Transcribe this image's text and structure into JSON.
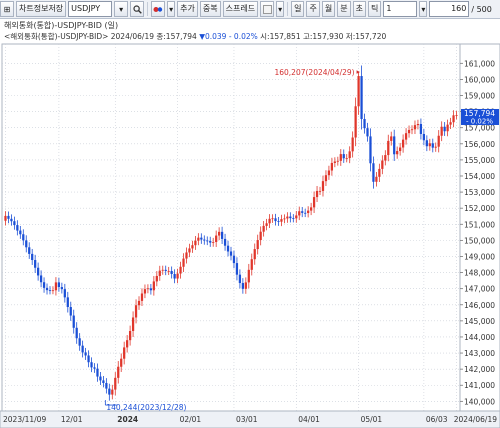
{
  "toolbar": {
    "expand_label": "⊞",
    "save_label": "차트정보저장",
    "symbol": "USDJPY",
    "add_label": "추가",
    "overlay_label": "중복",
    "spread_label": "스프레드",
    "periods": [
      "일",
      "주",
      "월",
      "분",
      "초",
      "틱"
    ],
    "interval_value": "1",
    "count_value": "160",
    "total_value": "/ 500"
  },
  "header": {
    "title": "해외통화(통합)-USDJPY-BID",
    "subtitle_name": "<해외통화(통합)-USDJPY-BID> 2024/06/19 종:157,794",
    "subtitle_change": "▼0.039  - 0.02%",
    "subtitle_rest": "시:157,851 고:157,930 저:157,720"
  },
  "chart_data": {
    "type": "candlestick",
    "title": "해외통화(통합)-USDJPY-BID (일)",
    "ylim": [
      139.4,
      162.2
    ],
    "y_ticks": [
      140,
      141,
      142,
      143,
      144,
      145,
      146,
      147,
      148,
      149,
      150,
      151,
      152,
      153,
      154,
      155,
      156,
      157,
      158,
      159,
      160,
      161
    ],
    "y_tick_labels": [
      "140,000",
      "141,000",
      "142,000",
      "143,000",
      "144,000",
      "145,000",
      "146,000",
      "147,000",
      "148,000",
      "149,000",
      "150,000",
      "151,000",
      "152,000",
      "153,000",
      "154,000",
      "155,000",
      "156,000",
      "157,000",
      "158,000",
      "159,000",
      "160,000",
      "161,000"
    ],
    "x_labels": [
      {
        "index": 0,
        "label": "2023/11/09"
      },
      {
        "index": 18,
        "label": "12/01"
      },
      {
        "index": 37,
        "label": "2024"
      },
      {
        "index": 58,
        "label": "02/01"
      },
      {
        "index": 77,
        "label": "03/01"
      },
      {
        "index": 98,
        "label": "04/01"
      },
      {
        "index": 119,
        "label": "05/01"
      },
      {
        "index": 141,
        "label": "06/03"
      },
      {
        "index": 152,
        "label": "2024/06/19"
      }
    ],
    "markers": {
      "high": {
        "index": 119,
        "value": 160.207,
        "label": "160,207(2024/04/29)"
      },
      "low": {
        "index": 35,
        "value": 140.244,
        "label": "140,244(2023/12/28)"
      }
    },
    "last": {
      "price_label": "157,794",
      "change_label": "- 0.02%"
    },
    "close": [
      151.52,
      151.34,
      151.19,
      150.95,
      150.61,
      150.38,
      150.0,
      149.57,
      149.16,
      148.78,
      148.3,
      147.82,
      147.4,
      147.05,
      146.91,
      146.9,
      146.9,
      147.39,
      147.1,
      146.97,
      146.46,
      145.86,
      145.33,
      144.57,
      143.92,
      143.46,
      143.04,
      142.85,
      142.43,
      142.11,
      142.03,
      141.54,
      141.3,
      141.14,
      140.79,
      140.42,
      140.73,
      141.46,
      142.15,
      142.65,
      143.35,
      143.8,
      144.37,
      145.21,
      145.97,
      146.24,
      146.7,
      146.97,
      147.02,
      146.9,
      147.45,
      147.79,
      148.12,
      148.17,
      148.1,
      148.1,
      147.91,
      147.63,
      147.94,
      148.36,
      148.87,
      149.25,
      149.5,
      149.7,
      149.98,
      150.17,
      150.05,
      149.99,
      149.96,
      149.86,
      149.9,
      150.3,
      150.53,
      150.09,
      149.67,
      149.31,
      149.05,
      148.59,
      147.87,
      147.35,
      146.99,
      147.39,
      148.17,
      148.83,
      149.46,
      150.02,
      150.54,
      150.9,
      151.06,
      151.34,
      151.37,
      151.2,
      151.16,
      151.32,
      151.36,
      151.48,
      151.38,
      151.37,
      151.55,
      151.81,
      151.71,
      151.7,
      151.85,
      152.05,
      152.69,
      153.07,
      153.07,
      153.68,
      154.05,
      154.34,
      154.81,
      154.9,
      154.94,
      155.36,
      155.1,
      155.11,
      155.53,
      156.39,
      158.33,
      160.21,
      157.54,
      156.97,
      156.46,
      154.79,
      153.64,
      153.95,
      154.44,
      154.96,
      155.3,
      156.18,
      156.46,
      155.35,
      155.55,
      155.77,
      156.26,
      156.66,
      156.86,
      156.9,
      157.16,
      157.23,
      156.61,
      156.22,
      155.85,
      156.03,
      155.76,
      155.82,
      156.5,
      157.06,
      156.78,
      157.19,
      157.34,
      157.77,
      157.79
    ]
  }
}
